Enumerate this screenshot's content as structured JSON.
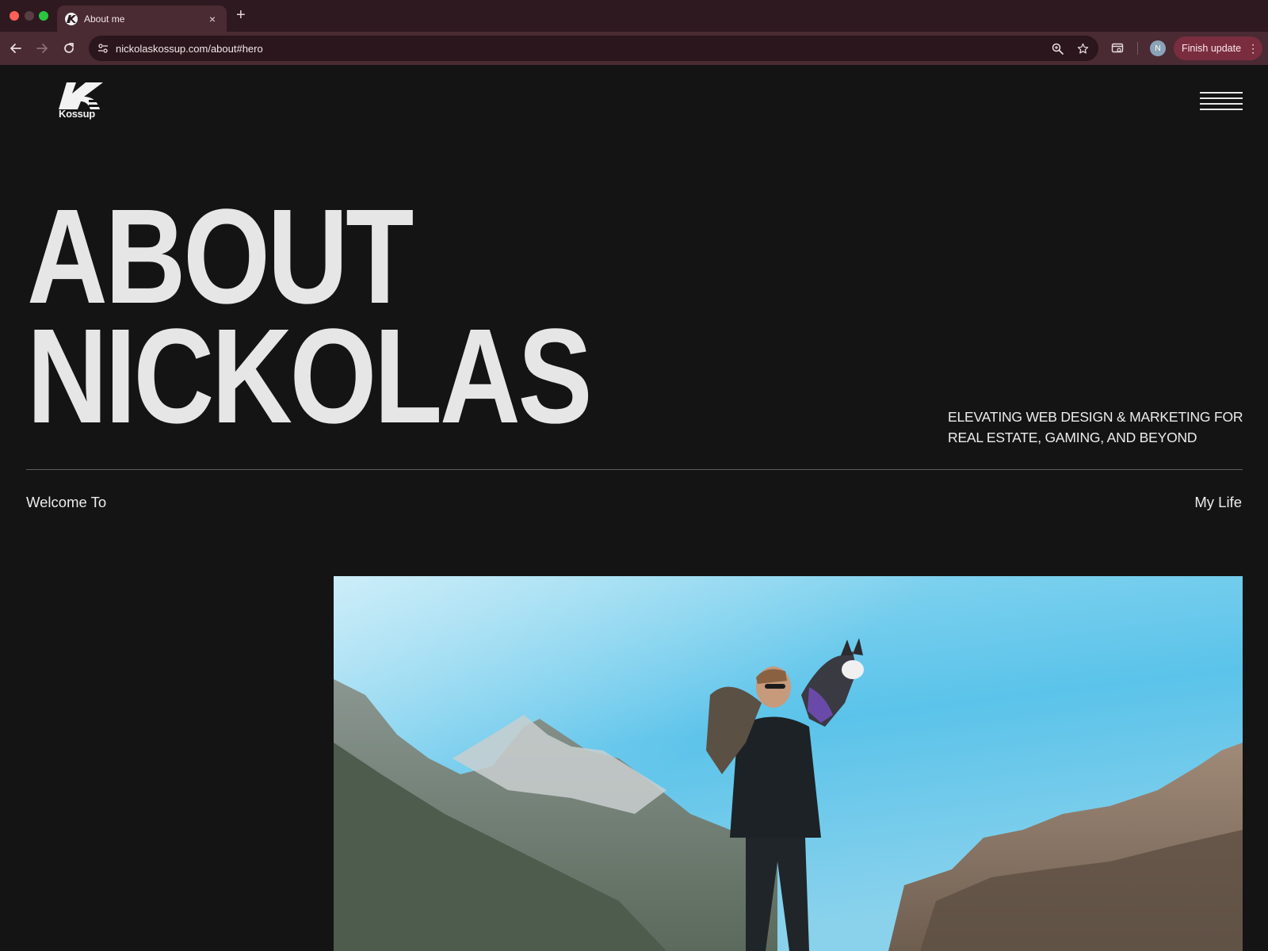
{
  "browser": {
    "tab": {
      "title": "About me",
      "close": "×"
    },
    "new_tab": "+",
    "url": "nickolaskossup.com/about#hero",
    "profile_initial": "N",
    "finish_update_label": "Finish update",
    "menu_dots": "⋮"
  },
  "site": {
    "logo_text": "Kossup",
    "hero": {
      "line1": "ABOUT",
      "line2": "NICKOLAS"
    },
    "tagline": {
      "line1": "ELEVATING WEB DESIGN & MARKETING FOR",
      "line2": "REAL ESTATE, GAMING, AND BEYOND"
    },
    "welcome": "Welcome To",
    "my_life": "My Life"
  },
  "icons": {
    "back": "arrow-left-icon",
    "forward": "arrow-right-icon",
    "reload": "reload-icon",
    "site_info": "tune-icon",
    "zoom": "zoom-icon",
    "bookmark": "star-icon",
    "cast": "tab-search-icon",
    "menu": "hamburger-icon"
  },
  "colors": {
    "tabbar": "#2e1920",
    "toolbar": "#4a2a33",
    "page_bg": "#141414",
    "hero_text": "#e6e6e6",
    "finish_update_bg": "#7a2d3f"
  }
}
